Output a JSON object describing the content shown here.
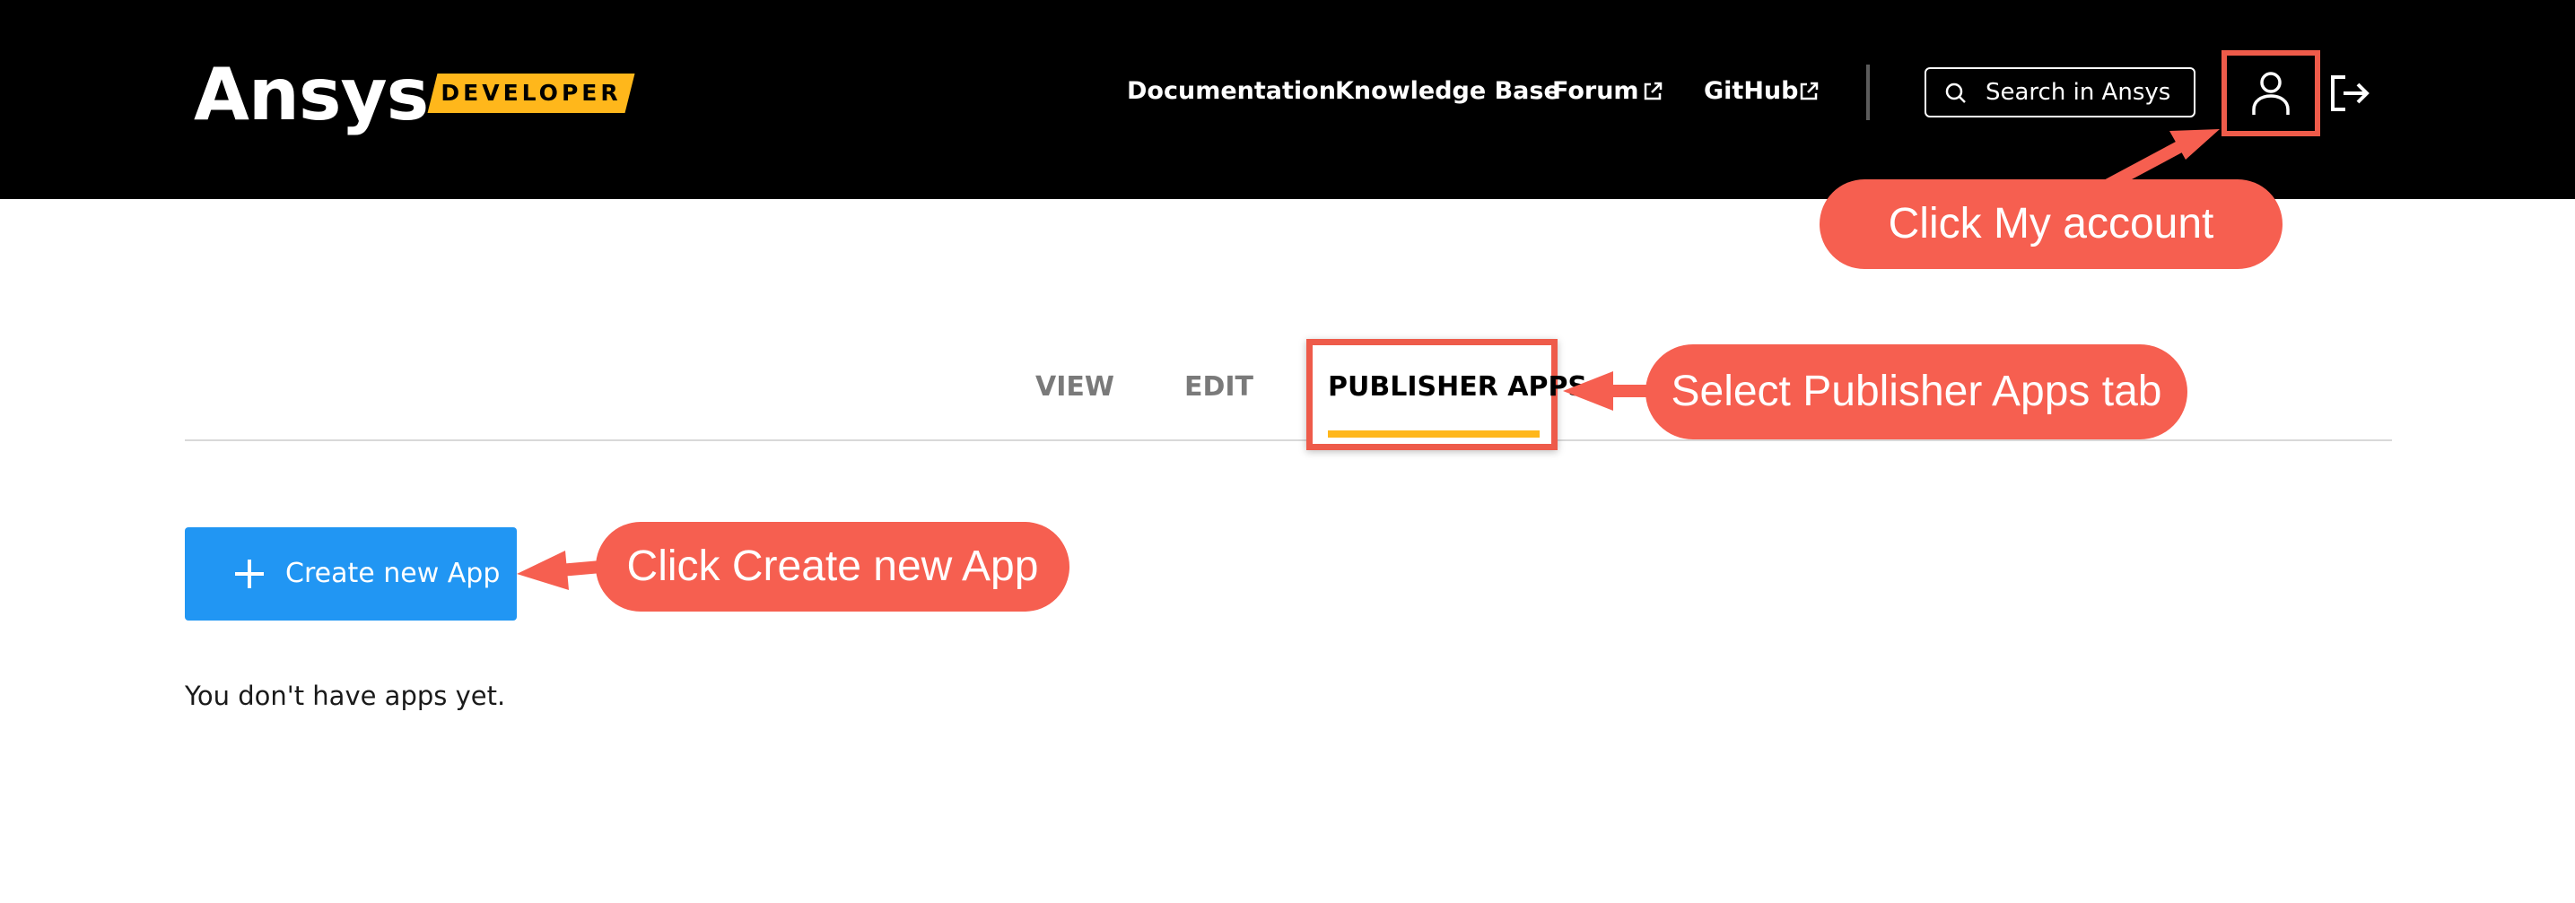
{
  "header": {
    "logo_text": "Ansys",
    "logo_badge": "DEVELOPER",
    "nav": {
      "documentation": "Documentation",
      "knowledge_base": "Knowledge Base",
      "forum": "Forum",
      "github": "GitHub"
    },
    "search": {
      "placeholder": "Search in Ansys"
    }
  },
  "tabs": [
    {
      "label": "VIEW",
      "active": false
    },
    {
      "label": "EDIT",
      "active": false
    },
    {
      "label": "PUBLISHER APPS",
      "active": true
    }
  ],
  "main": {
    "create_button_label": "Create new App",
    "empty_message": "You don't have apps yet."
  },
  "annotations": {
    "my_account": "Click My account",
    "publisher_tab": "Select Publisher Apps tab",
    "create_app": "Click Create new App"
  },
  "colors": {
    "header_bg": "#000000",
    "brand_accent": "#ffb71b",
    "primary_button": "#2196f3",
    "annotation": "#f65f50"
  }
}
